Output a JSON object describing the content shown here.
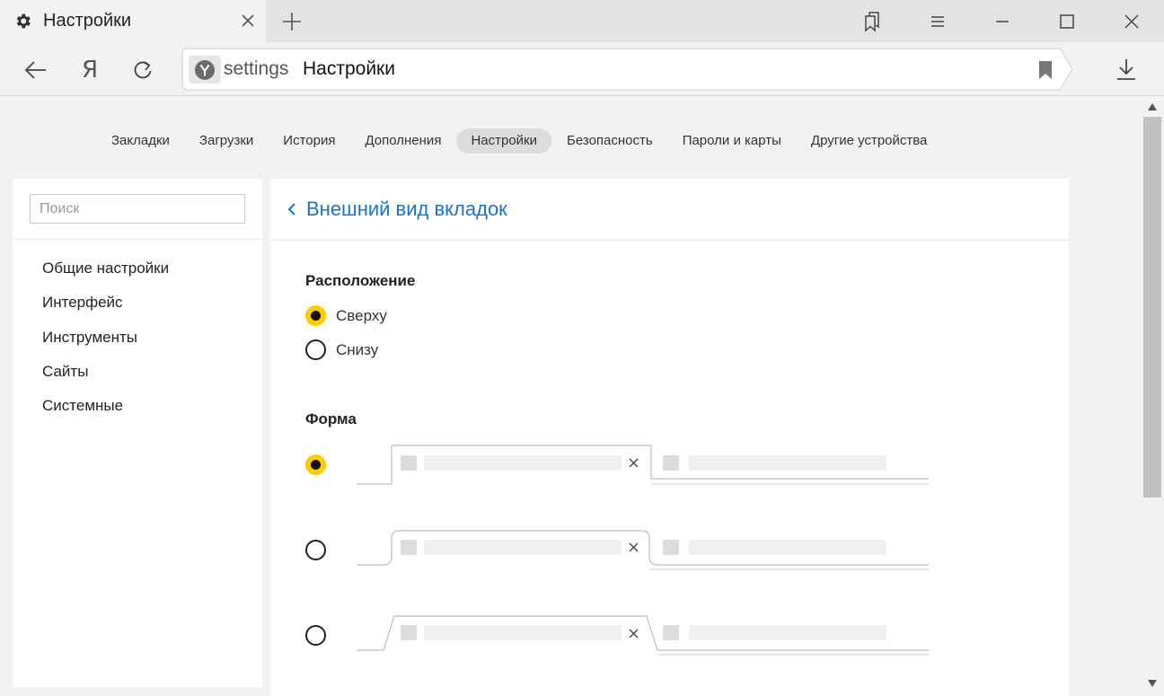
{
  "window": {
    "tab_title": "Настройки",
    "tab_icon": "gear-icon"
  },
  "toolbar": {
    "yandex_label": "Я",
    "omnibox_host": "settings",
    "omnibox_title": "Настройки"
  },
  "settings_nav": [
    {
      "label": "Закладки",
      "active": false
    },
    {
      "label": "Загрузки",
      "active": false
    },
    {
      "label": "История",
      "active": false
    },
    {
      "label": "Дополнения",
      "active": false
    },
    {
      "label": "Настройки",
      "active": true
    },
    {
      "label": "Безопасность",
      "active": false
    },
    {
      "label": "Пароли и карты",
      "active": false
    },
    {
      "label": "Другие устройства",
      "active": false
    }
  ],
  "sidebar": {
    "search_placeholder": "Поиск",
    "items": [
      {
        "label": "Общие настройки"
      },
      {
        "label": "Интерфейс"
      },
      {
        "label": "Инструменты"
      },
      {
        "label": "Сайты"
      },
      {
        "label": "Системные"
      }
    ]
  },
  "panel": {
    "title": "Внешний вид вкладок",
    "position": {
      "title": "Расположение",
      "options": [
        {
          "label": "Сверху",
          "checked": true
        },
        {
          "label": "Снизу",
          "checked": false
        }
      ]
    },
    "shape": {
      "title": "Форма",
      "options": [
        {
          "shape": "rectangular",
          "checked": true
        },
        {
          "shape": "rounded",
          "checked": false
        },
        {
          "shape": "trapezoid",
          "checked": false
        }
      ]
    }
  },
  "colors": {
    "accent_yellow": "#ffcc00",
    "link_blue": "#1a73c8",
    "background": "#f2f2f2"
  }
}
